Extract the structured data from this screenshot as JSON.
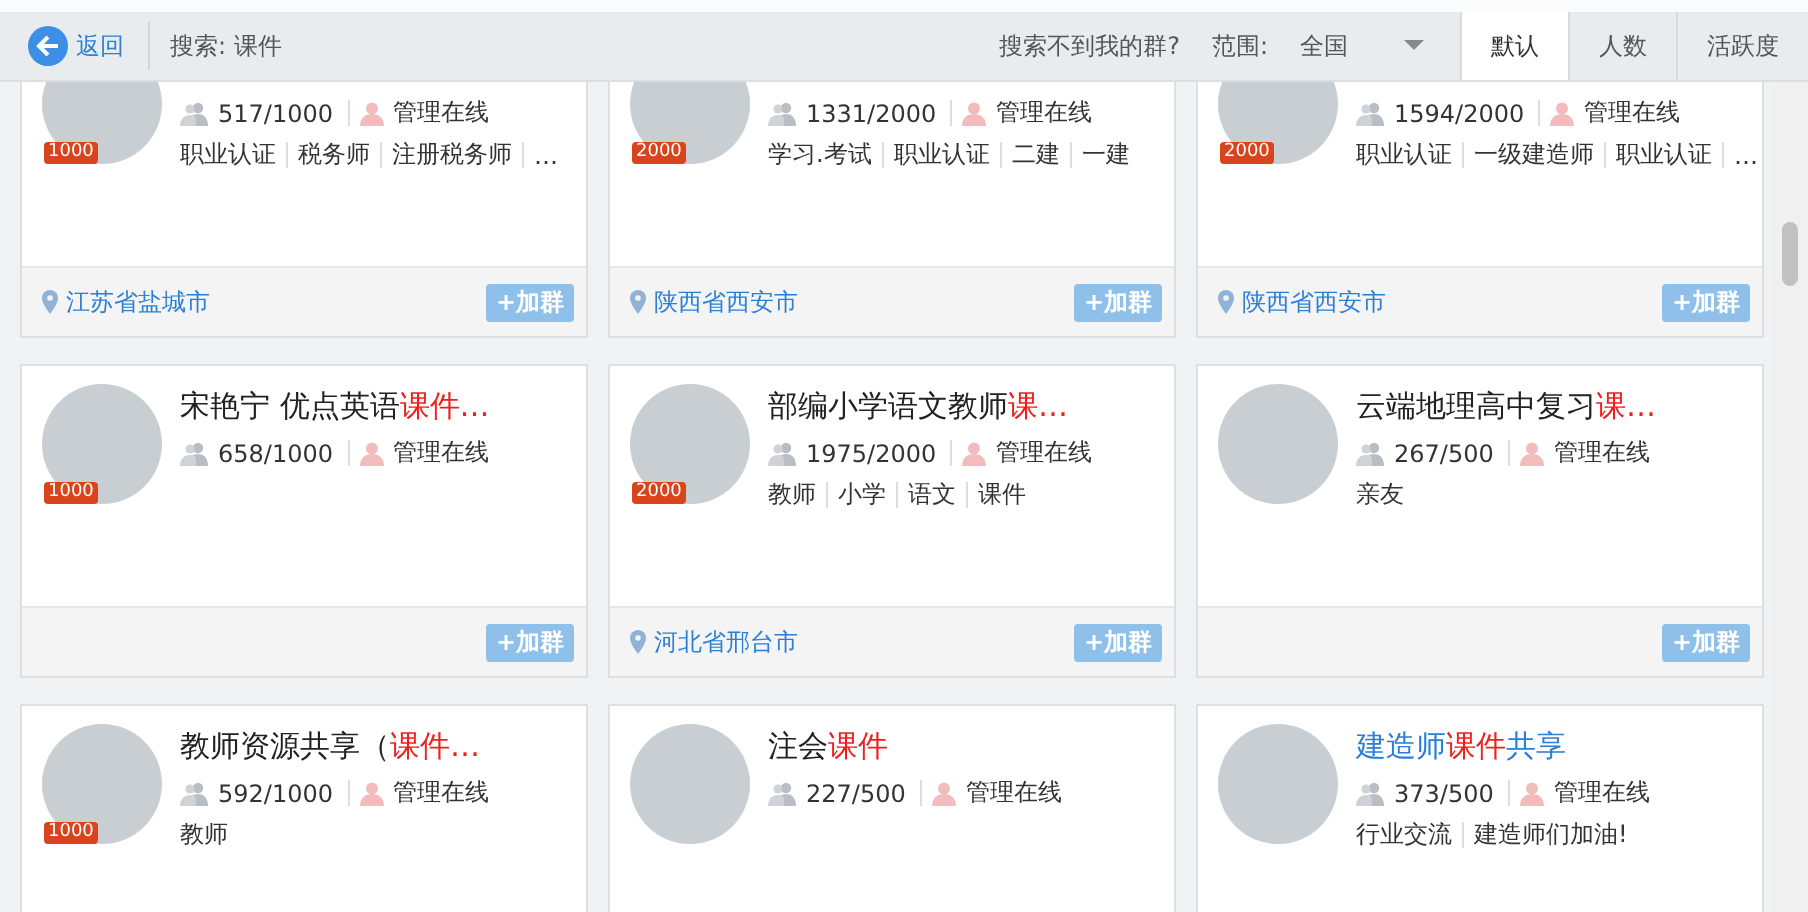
{
  "toolbar": {
    "back_label": "返回",
    "search_text": "搜索: 课件",
    "not_found_link": "搜索不到我的群?",
    "scope_label": "范围:",
    "scope_value": "全国"
  },
  "sort_tabs": [
    {
      "label": "默认",
      "selected": true
    },
    {
      "label": "人数",
      "selected": false
    },
    {
      "label": "活跃度",
      "selected": false
    }
  ],
  "groups": [
    {
      "badge": "1000",
      "members": "517/1000",
      "admin": "管理在线",
      "tags": [
        "职业认证",
        "税务师",
        "注册税务师",
        "…"
      ],
      "location": "江苏省盐城市",
      "join_button": "+加群"
    },
    {
      "badge": "2000",
      "members": "1331/2000",
      "admin": "管理在线",
      "tags": [
        "学习.考试",
        "职业认证",
        "二建",
        "一建"
      ],
      "location": "陕西省西安市",
      "join_button": "+加群"
    },
    {
      "badge": "2000",
      "members": "1594/2000",
      "admin": "管理在线",
      "tags": [
        "职业认证",
        "一级建造师",
        "职业认证",
        "…"
      ],
      "location": "陕西省西安市",
      "join_button": "+加群"
    },
    {
      "title_link": false,
      "title": [
        {
          "text": "宋艳宁 优点英语",
          "highlight": false
        },
        {
          "text": "课件…",
          "highlight": true
        }
      ],
      "badge": "1000",
      "members": "658/1000",
      "admin": "管理在线",
      "join_button": "+加群"
    },
    {
      "title_link": false,
      "title": [
        {
          "text": "部编小学语文教师",
          "highlight": false
        },
        {
          "text": "课…",
          "highlight": true
        }
      ],
      "badge": "2000",
      "members": "1975/2000",
      "admin": "管理在线",
      "tags": [
        "教师",
        "小学",
        "语文",
        "课件"
      ],
      "location": "河北省邢台市",
      "join_button": "+加群"
    },
    {
      "title_link": false,
      "title": [
        {
          "text": "云端地理高中复习",
          "highlight": false
        },
        {
          "text": "课…",
          "highlight": true
        }
      ],
      "members": "267/500",
      "admin": "管理在线",
      "tags": [
        "亲友"
      ],
      "join_button": "+加群"
    },
    {
      "title_link": false,
      "title": [
        {
          "text": "教师资源共享（",
          "highlight": false
        },
        {
          "text": "课件…",
          "highlight": true
        }
      ],
      "badge": "1000",
      "members": "592/1000",
      "admin": "管理在线",
      "tags": [
        "教师"
      ]
    },
    {
      "title_link": false,
      "title": [
        {
          "text": "注会",
          "highlight": false
        },
        {
          "text": "课件",
          "highlight": true
        }
      ],
      "members": "227/500",
      "admin": "管理在线"
    },
    {
      "title_link": true,
      "title": [
        {
          "text": "建造师",
          "highlight": false
        },
        {
          "text": "课件",
          "highlight": true
        },
        {
          "text": "共享",
          "highlight": false
        }
      ],
      "members": "373/500",
      "admin": "管理在线",
      "tags": [
        "行业交流",
        "建造师们加油!"
      ]
    }
  ]
}
